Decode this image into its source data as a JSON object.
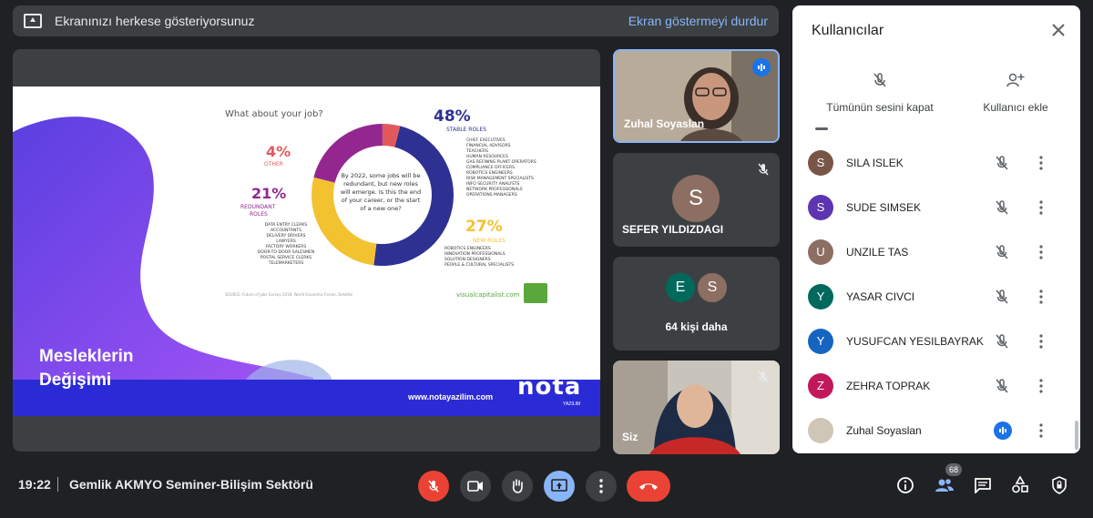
{
  "presenting": {
    "message": "Ekranınızı herkese gösteriyorsunuz",
    "stop_label": "Ekran göstermeyi durdur"
  },
  "slide": {
    "title_line1": "Mesleklerin",
    "title_line2": "Değişimi",
    "website": "www.notayazilim.com",
    "logo": "nota",
    "logo_sub": "YAZILIM",
    "infographic": {
      "question": "What about your job?",
      "center_text": "By 2022, some jobs will be redundant, but new roles will emerge. Is this the end of your career, or the start of a new one?",
      "stable_pct": "48%",
      "stable_label": "STABLE ROLES",
      "stable_roles": [
        "CHIEF EXECUTIVES",
        "FINANCIAL ADVISORS",
        "TEACHERS",
        "HUMAN RESOURCES",
        "GAS REFINING PLANT OPERATORS",
        "COMPLIANCE OFFICERS",
        "ROBOTICS ENGINEERS",
        "RISK MANAGEMENT SPECIALISTS",
        "INFO SECURITY ANALYSTS",
        "NETWORK PROFESSIONALS",
        "OPERATIONS MANAGERS"
      ],
      "other_pct": "4%",
      "other_label": "OTHER",
      "redundant_pct": "21%",
      "redundant_label_1": "REDUNDANT",
      "redundant_label_2": "ROLES",
      "redundant_roles": [
        "DATA ENTRY CLERKS",
        "ACCOUNTANTS",
        "DELIVERY DRIVERS",
        "LAWYERS",
        "FACTORY WORKERS",
        "DOOR-TO-DOOR SALESMEN",
        "POSTAL SERVICE CLERKS",
        "TELEMARKETERS"
      ],
      "new_pct": "27%",
      "new_label": "NEW ROLES",
      "new_roles": [
        "ROBOTICS ENGINEERS",
        "INNOVATION PROFESSIONALS",
        "SOLUTION DESIGNERS",
        "PEOPLE & CULTURAL SPECIALISTS"
      ],
      "source": "SOURCE: Future of Jobs Survey 2018, World Economic Forum, Deloitte",
      "brand": "visualcapitalist.com",
      "colors": {
        "stable": "#2e3192",
        "new": "#f2c230",
        "redundant": "#93278f",
        "other": "#e2595c"
      },
      "shares": {
        "stable": 48,
        "new": 27,
        "redundant": 21,
        "other": 4
      }
    }
  },
  "tiles": {
    "speaker_name": "Zuhal Soyaslan",
    "sefer_initial": "S",
    "sefer_name": "SEFER YILDIZDAGI",
    "others_initial_1": "E",
    "others_initial_2": "S",
    "others_label": "64 kişi daha",
    "self_name": "Siz"
  },
  "panel": {
    "title": "Kullanıcılar",
    "mute_all": "Tümünün sesini kapat",
    "add_user": "Kullanıcı ekle",
    "participants": [
      {
        "initial": "S",
        "name": "SILA ISLEK",
        "color": "#795548"
      },
      {
        "initial": "S",
        "name": "SUDE SIMSEK",
        "color": "#5e35b1"
      },
      {
        "initial": "U",
        "name": "UNZILE TAS",
        "color": "#8d6e63"
      },
      {
        "initial": "Y",
        "name": "YASAR CIVCI",
        "color": "#00695c"
      },
      {
        "initial": "Y",
        "name": "YUSUFCAN YESILBAYRAK",
        "color": "#1565c0"
      },
      {
        "initial": "Z",
        "name": "ZEHRA TOPRAK",
        "color": "#c2185b"
      },
      {
        "initial": "",
        "name": "Zuhal Soyaslan",
        "color": "#cfc6b8"
      }
    ]
  },
  "bottom": {
    "time": "19:22",
    "meeting_name": "Gemlik AKMYO Seminer-Bilişim Sektörü",
    "participant_count": "68"
  },
  "colors": {
    "end_call": "#ea4335",
    "accent": "#8ab4f8",
    "speaking": "#1a73e8"
  }
}
